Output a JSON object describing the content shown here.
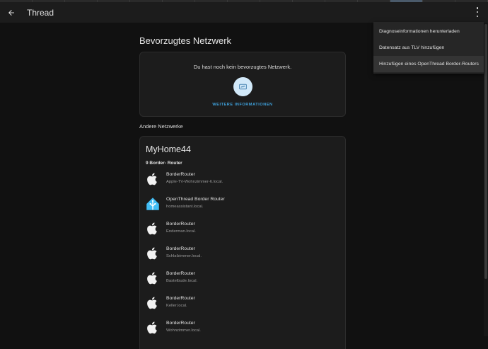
{
  "topbar": {
    "title": "Thread"
  },
  "preferred": {
    "heading": "Bevorzugtes Netzwerk",
    "empty_text": "Du hast noch kein bevorzugtes Netzwerk.",
    "more_info": "WEITERE INFORMATIONEN"
  },
  "other": {
    "heading": "Andere Netzwerke",
    "network_name": "MyHome44",
    "router_count": "9 Border- Router",
    "routers": [
      {
        "icon": "apple-icon",
        "name": "BorderRouter",
        "host": "Apple-TV-Wohnzimmer-6.local."
      },
      {
        "icon": "home-assistant-icon",
        "name": "OpenThread Border Router",
        "host": "homeassistant.local."
      },
      {
        "icon": "apple-icon",
        "name": "BorderRouter",
        "host": "Enderman.local."
      },
      {
        "icon": "apple-icon",
        "name": "BorderRouter",
        "host": "Schlafzimmer.local."
      },
      {
        "icon": "apple-icon",
        "name": "BorderRouter",
        "host": "Bastelbude.local."
      },
      {
        "icon": "apple-icon",
        "name": "BorderRouter",
        "host": "Keller.local."
      },
      {
        "icon": "apple-icon",
        "name": "BorderRouter",
        "host": "Wohnzimmer.local."
      }
    ]
  },
  "menu": {
    "items": [
      "Diagnoseinformationen herunterladen",
      "Datensatz aus TLV hinzufügen",
      "Hinzufügen eines OpenThread Border-Routers"
    ]
  },
  "colors": {
    "background": "#111111",
    "card": "#1c1c1c",
    "accent": "#3fa2dd",
    "icon_circle": "#d2e9f9",
    "home_assistant": "#41bdf5"
  }
}
